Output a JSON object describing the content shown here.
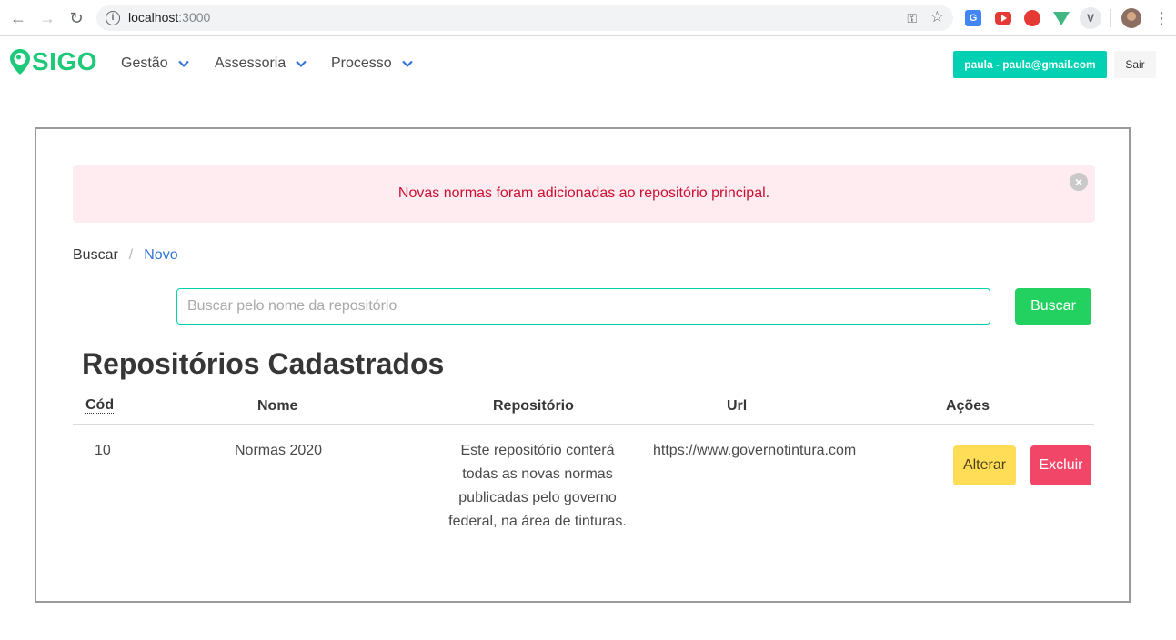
{
  "browser": {
    "url_host": "localhost",
    "url_port": ":3000",
    "ext_translate": "G",
    "ext_v": "V"
  },
  "navbar": {
    "logo_text": "SIGO",
    "menus": [
      {
        "label": "Gestão"
      },
      {
        "label": "Assessoria"
      },
      {
        "label": "Processo"
      }
    ],
    "user_label": "paula - paula@gmail.com",
    "exit_label": "Sair"
  },
  "notification": {
    "message": "Novas normas foram adicionadas ao repositório principal.",
    "close": "×"
  },
  "breadcrumb": {
    "items": [
      "Buscar",
      "Novo"
    ],
    "separator": "/"
  },
  "search": {
    "placeholder": "Buscar pelo nome da repositório",
    "value": "",
    "button_label": "Buscar"
  },
  "section_title": "Repositórios Cadastrados",
  "table": {
    "headers": [
      "Cód",
      "Nome",
      "Repositório",
      "Url",
      "Ações"
    ],
    "rows": [
      {
        "cod": "10",
        "nome": "Normas 2020",
        "repositorio": "Este repositório conterá todas as novas normas publicadas pelo governo federal, na área de tinturas.",
        "url": "https://www.governotintura.com",
        "alterar": "Alterar",
        "excluir": "Excluir"
      }
    ]
  },
  "colors": {
    "brand": "#1ec97a",
    "primary": "#00d1b2",
    "success": "#23d160",
    "warning": "#ffdd57",
    "danger": "#f14668",
    "link": "#3273dc",
    "notification_bg": "#feecf0",
    "notification_text": "#cc0f35"
  }
}
